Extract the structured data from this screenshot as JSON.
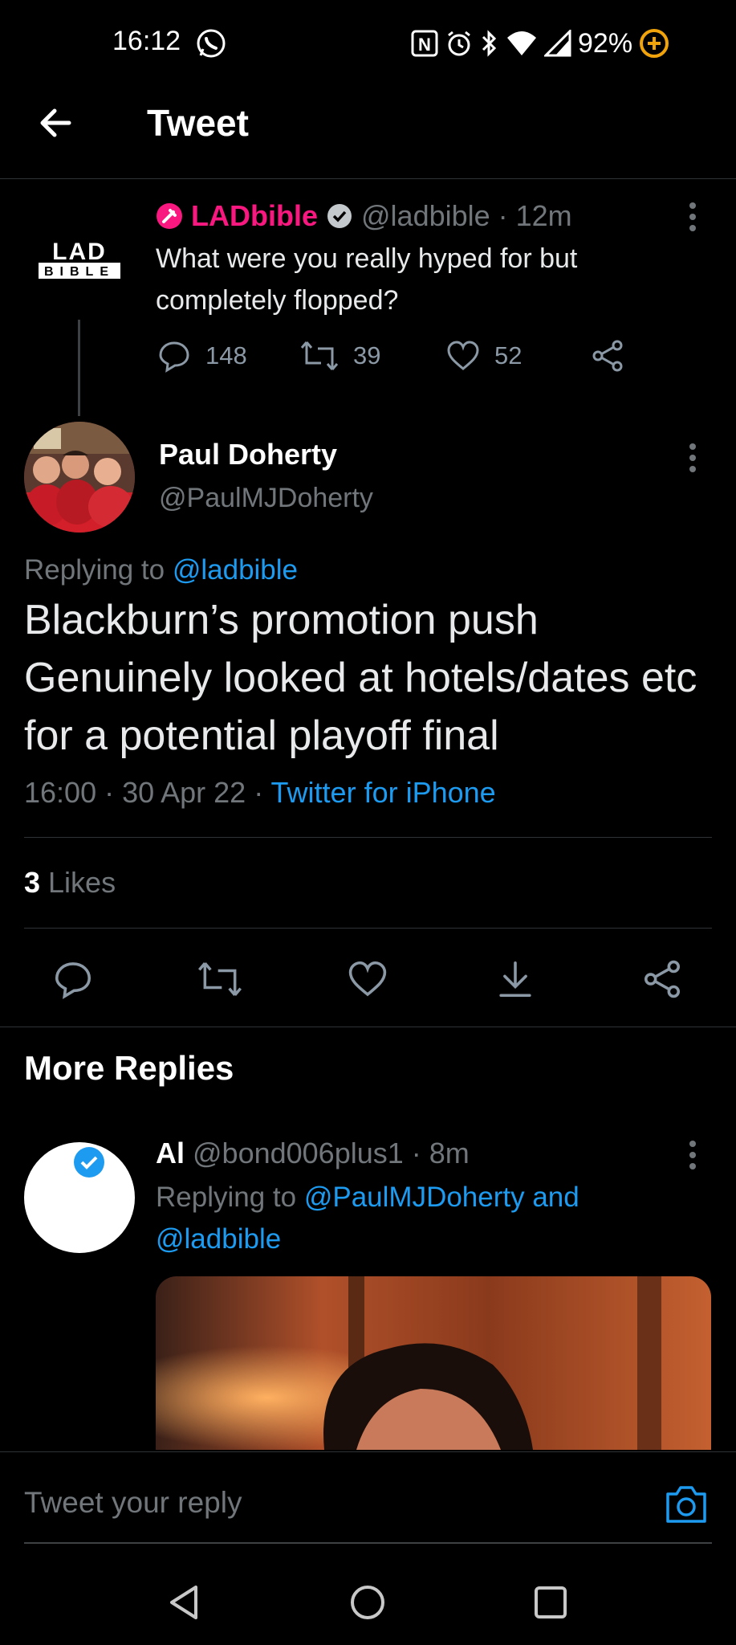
{
  "status_bar": {
    "time": "16:12",
    "battery": "92%"
  },
  "header": {
    "title": "Tweet"
  },
  "parent_tweet": {
    "logo_text_top": "LAD",
    "logo_text_bottom": "BIBLE",
    "name": "LADbible",
    "handle_time": "@ladbible · 12m",
    "text": "What were you really hyped for but completely flopped?",
    "replies": "148",
    "retweets": "39",
    "likes": "52"
  },
  "main_tweet": {
    "name": "Paul Doherty",
    "handle": "@PaulMJDoherty",
    "replying_prefix": "Replying to ",
    "replying_handle": "@ladbible",
    "text": "Blackburn’s promotion push Genuinely looked at hotels/dates etc for a potential playoff final",
    "time_date": "16:00 · 30 Apr 22 · ",
    "source": "Twitter for iPhone",
    "likes_count": "3",
    "likes_label": " Likes"
  },
  "more_replies": {
    "title": "More Replies"
  },
  "reply": {
    "name": "Al",
    "handle_time": " @bond006plus1 · 8m",
    "replying_prefix": "Replying to ",
    "replying_handles": "@PaulMJDoherty and @ladbible"
  },
  "composer": {
    "placeholder": "Tweet your reply"
  },
  "colors": {
    "accent": "#1d9bf0",
    "ladbible_pink": "#f91880",
    "muted": "#71767b",
    "battery_saver": "#f0a30a"
  }
}
